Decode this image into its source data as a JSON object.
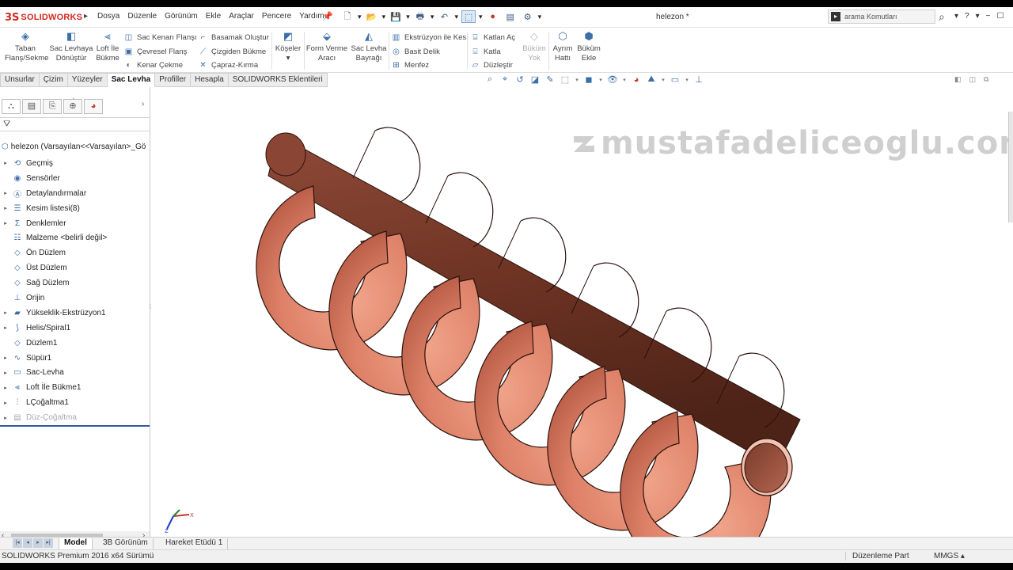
{
  "app": {
    "logo_mark": "3S",
    "logo_text": "SOLIDWORKS",
    "menu": [
      "Dosya",
      "Düzenle",
      "Görünüm",
      "Ekle",
      "Araçlar",
      "Pencere",
      "Yardım"
    ],
    "document_title": "helezon *",
    "search_placeholder": "arama Komutları",
    "help_label": "?"
  },
  "command_manager": {
    "big_buttons": [
      {
        "label": "Taban Flanş/Sekme",
        "icon": "base-flange-icon"
      },
      {
        "label": "Sac Levhaya Dönüştür",
        "icon": "convert-to-sheet-metal-icon"
      },
      {
        "label": "Loft İle Bükme",
        "icon": "lofted-bend-icon"
      },
      {
        "label": "Köşeler",
        "icon": "corners-icon"
      },
      {
        "label": "Form Verme Aracı",
        "icon": "forming-tool-icon"
      },
      {
        "label": "Sac Levha Bayrağı",
        "icon": "sheet-metal-gusset-icon"
      },
      {
        "label": "Büküm Yok",
        "icon": "no-bends-icon",
        "disabled": true
      },
      {
        "label": "Ayrım Hattı",
        "icon": "rip-icon"
      },
      {
        "label": "Büküm Ekle",
        "icon": "insert-bends-icon"
      }
    ],
    "col1": [
      "Sac Kenarı Flanşı",
      "Çevresel Flanş",
      "Kenar Çekme"
    ],
    "col2": [
      "Basamak Oluştur",
      "Çizgiden Bükme",
      "Çapraz-Kırma"
    ],
    "col3": [
      "Ekstrüzyon ile Kes",
      "Basit Delik",
      "Menfez"
    ],
    "col4": [
      "Katlan Aç",
      "Katla",
      "Düzleştir"
    ]
  },
  "tabs": [
    "Unsurlar",
    "Çizim",
    "Yüzeyler",
    "Sac Levha",
    "Profiller",
    "Hesapla",
    "SOLIDWORKS Eklentileri"
  ],
  "active_tab": "Sac Levha",
  "feature_tree": {
    "root": "helezon  (Varsayılan<<Varsayılan>_Gö",
    "nodes": [
      {
        "label": "Geçmiş",
        "icon": "history-icon",
        "expandable": true
      },
      {
        "label": "Sensörler",
        "icon": "sensors-icon",
        "expandable": false
      },
      {
        "label": "Detaylandırmalar",
        "icon": "annotations-icon",
        "expandable": true
      },
      {
        "label": "Kesim listesi(8)",
        "icon": "cut-list-icon",
        "expandable": true
      },
      {
        "label": "Denklemler",
        "icon": "equations-icon",
        "expandable": true
      },
      {
        "label": "Malzeme <belirli değil>",
        "icon": "material-icon",
        "expandable": false
      },
      {
        "label": "Ön Düzlem",
        "icon": "plane-icon",
        "expandable": false
      },
      {
        "label": "Üst Düzlem",
        "icon": "plane-icon",
        "expandable": false
      },
      {
        "label": "Sağ Düzlem",
        "icon": "plane-icon",
        "expandable": false
      },
      {
        "label": "Orijin",
        "icon": "origin-icon",
        "expandable": false
      },
      {
        "label": "Yükseklik-Ekstrüzyon1",
        "icon": "extrude-icon",
        "expandable": true
      },
      {
        "label": "Helis/Spiral1",
        "icon": "helix-icon",
        "expandable": true
      },
      {
        "label": "Düzlem1",
        "icon": "plane-icon",
        "expandable": false
      },
      {
        "label": "Süpür1",
        "icon": "sweep-icon",
        "expandable": true
      },
      {
        "label": "Sac-Levha",
        "icon": "sheet-metal-icon",
        "expandable": true
      },
      {
        "label": "Loft İle Bükme1",
        "icon": "lofted-bend-icon",
        "expandable": true
      },
      {
        "label": "LÇoğaltma1",
        "icon": "linear-pattern-icon",
        "expandable": true
      },
      {
        "label": "Düz-Çoğaltma",
        "icon": "flat-pattern-icon",
        "expandable": true,
        "suppressed": true
      }
    ]
  },
  "viewport": {
    "watermark": "mustafadeliceoglu.com",
    "model_color": "#d9785e"
  },
  "bottom_tabs": [
    "Model",
    "3B Görünüm",
    "Hareket Etüdü 1"
  ],
  "status": {
    "left": "SOLIDWORKS Premium 2016 x64 Sürümü",
    "mode": "Düzenleme Part",
    "units": "MMGS"
  }
}
